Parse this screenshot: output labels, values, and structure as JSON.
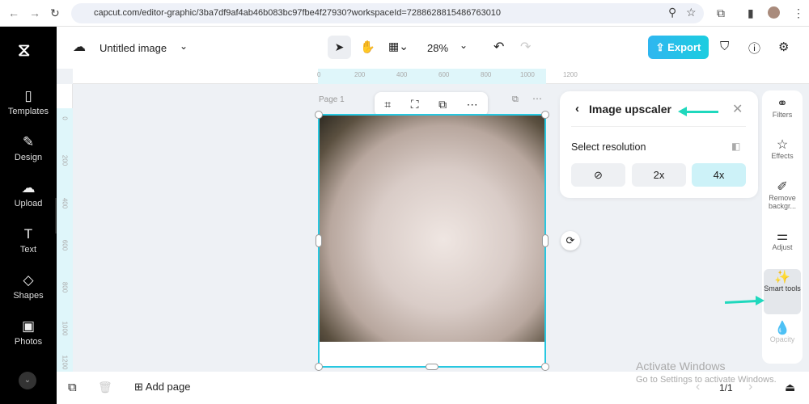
{
  "browser": {
    "url": "capcut.com/editor-graphic/3ba7df9af4ab46b083bc97fbe4f27930?workspaceId=7288628815486763010"
  },
  "sidebar": {
    "items": [
      {
        "label": "Templates",
        "icon": "▯"
      },
      {
        "label": "Design",
        "icon": "✎"
      },
      {
        "label": "Upload",
        "icon": "☁"
      },
      {
        "label": "Text",
        "icon": "T"
      },
      {
        "label": "Shapes",
        "icon": "◇"
      },
      {
        "label": "Photos",
        "icon": "▣"
      }
    ]
  },
  "header": {
    "title": "Untitled image",
    "zoom": "28%",
    "export_label": "Export"
  },
  "ruler": {
    "h": [
      "0",
      "200",
      "400",
      "600",
      "800",
      "1000",
      "1200"
    ],
    "v": [
      "0",
      "200",
      "400",
      "600",
      "800",
      "1000",
      "1200"
    ]
  },
  "canvas": {
    "page_label": "Page 1"
  },
  "upscaler": {
    "title": "Image upscaler",
    "section": "Select resolution",
    "options": [
      "2x",
      "4x"
    ],
    "selected": "4x"
  },
  "right_panel": {
    "items": [
      {
        "label": "Filters",
        "icon": "⚭"
      },
      {
        "label": "Effects",
        "icon": "☆"
      },
      {
        "label": "Remove backgr...",
        "icon": "✐"
      },
      {
        "label": "Adjust",
        "icon": "⚌"
      },
      {
        "label": "Smart tools",
        "icon": "✨"
      },
      {
        "label": "Opacity",
        "icon": "💧"
      }
    ]
  },
  "bottom": {
    "add_page": "Add page",
    "page_count": "1/1"
  },
  "watermark": {
    "line1": "Activate Windows",
    "line2": "Go to Settings to activate Windows."
  }
}
